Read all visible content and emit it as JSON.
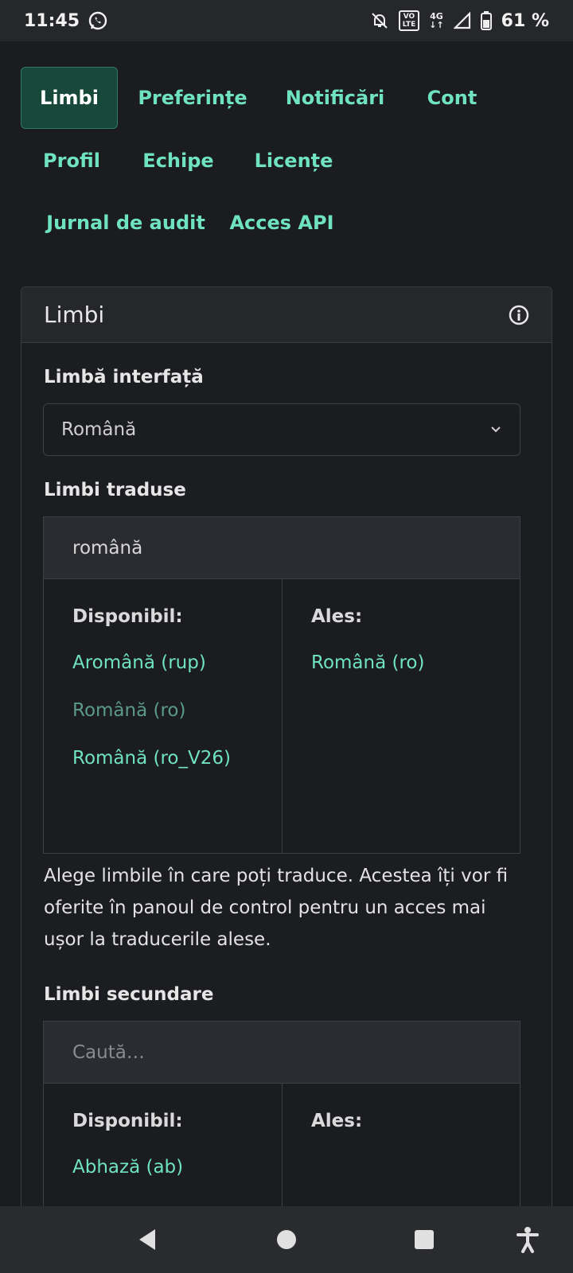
{
  "status_bar": {
    "time": "11:45",
    "icons": [
      "whatsapp-icon",
      "mute-notification-icon",
      "volte-icon",
      "4g-icon",
      "signal-icon",
      "battery-icon"
    ],
    "volte_line1": "VO",
    "volte_line2": "LTE",
    "network": "4G",
    "battery": "61 %"
  },
  "tabs": [
    "Limbi",
    "Preferințe",
    "Notificări",
    "Cont",
    "Profil",
    "Echipe",
    "Licențe",
    "Jurnal de audit",
    "Acces API"
  ],
  "active_tab": "Limbi",
  "card": {
    "title": "Limbi",
    "info_icon": "info-icon",
    "interface_language": {
      "label": "Limbă interfață",
      "value": "Română"
    },
    "translated_languages": {
      "label": "Limbi traduse",
      "search_value": "română",
      "available_header": "Disponibil:",
      "selected_header": "Ales:",
      "available": [
        "Aromână (rup)",
        "Română (ro)",
        "Română (ro_V26)"
      ],
      "selected": [
        "Română (ro)"
      ],
      "help": "Alege limbile în care poți traduce. Acestea îți vor fi oferite în panoul de control pentru un acces mai ușor la traducerile alese."
    },
    "secondary_languages": {
      "label": "Limbi secundare",
      "search_placeholder": "Caută…",
      "available_header": "Disponibil:",
      "selected_header": "Ales:",
      "available": [
        "Abhază (ab)"
      ]
    }
  },
  "colors": {
    "accent": "#6fe3c1",
    "active_tab_bg": "#17483a",
    "background": "#1b1c1e"
  }
}
